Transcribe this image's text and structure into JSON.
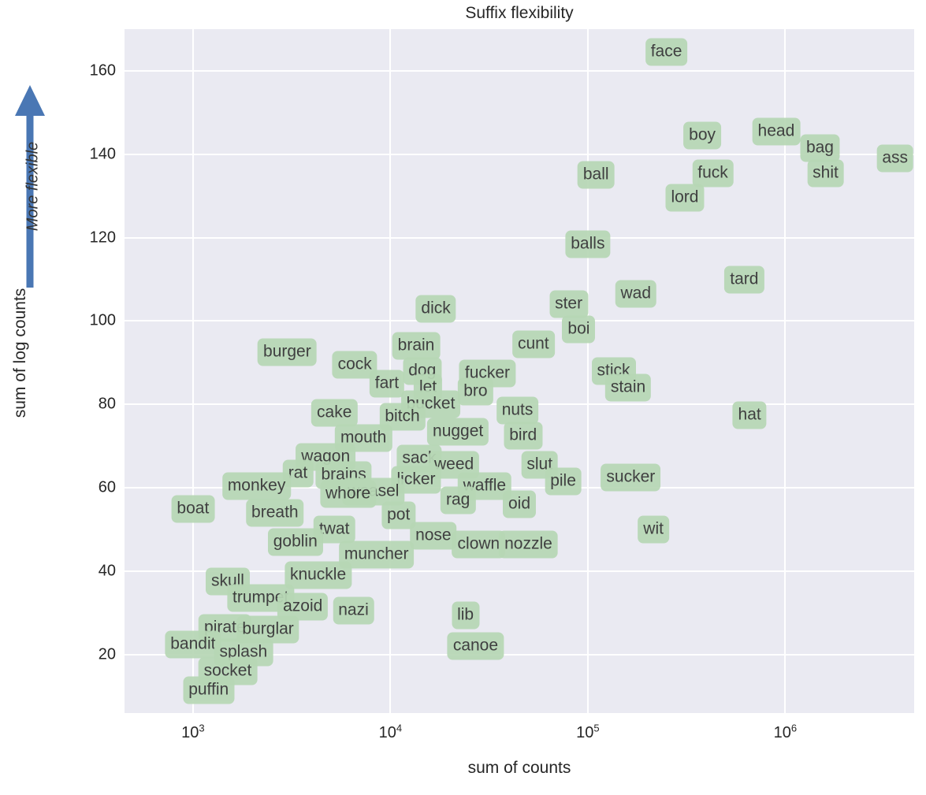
{
  "chart_data": {
    "type": "scatter",
    "title": "Suffix flexibility",
    "xlabel": "sum of counts",
    "ylabel": "sum of log counts",
    "xscale": "log",
    "yscale": "linear",
    "xlim": [
      450,
      4500000
    ],
    "ylim": [
      6,
      170
    ],
    "grid": true,
    "legend": null,
    "xticks": [
      {
        "value": 1000,
        "label_base": "10",
        "label_exp": "3"
      },
      {
        "value": 10000,
        "label_base": "10",
        "label_exp": "4"
      },
      {
        "value": 100000,
        "label_base": "10",
        "label_exp": "5"
      },
      {
        "value": 1000000,
        "label_base": "10",
        "label_exp": "6"
      }
    ],
    "yticks": [
      20,
      40,
      60,
      80,
      100,
      120,
      140,
      160
    ],
    "annotation": {
      "text": "More flexible",
      "arrow_direction": "up",
      "color": "#4a77b4"
    },
    "label_style": {
      "box_color": "#b7d7b5",
      "text_color": "#333333",
      "plot_background": "#eaeaf2",
      "grid_color": "#ffffff"
    },
    "points": [
      {
        "label": "face",
        "x": 250000,
        "y": 164.5
      },
      {
        "label": "boy",
        "x": 380000,
        "y": 144.5
      },
      {
        "label": "head",
        "x": 900000,
        "y": 145.5
      },
      {
        "label": "bag",
        "x": 1500000,
        "y": 141.5
      },
      {
        "label": "ass",
        "x": 3600000,
        "y": 139.0
      },
      {
        "label": "shit",
        "x": 1600000,
        "y": 135.5
      },
      {
        "label": "fuck",
        "x": 430000,
        "y": 135.5
      },
      {
        "label": "ball",
        "x": 110000,
        "y": 135.0
      },
      {
        "label": "lord",
        "x": 310000,
        "y": 129.5
      },
      {
        "label": "balls",
        "x": 100000,
        "y": 118.5
      },
      {
        "label": "tard",
        "x": 620000,
        "y": 110.0
      },
      {
        "label": "wad",
        "x": 175000,
        "y": 106.5
      },
      {
        "label": "ster",
        "x": 80000,
        "y": 104.0
      },
      {
        "label": "dick",
        "x": 17000,
        "y": 103.0
      },
      {
        "label": "boi",
        "x": 90000,
        "y": 98.0
      },
      {
        "label": "cunt",
        "x": 53000,
        "y": 94.5
      },
      {
        "label": "brain",
        "x": 13500,
        "y": 94.0
      },
      {
        "label": "burger",
        "x": 3000,
        "y": 92.5
      },
      {
        "label": "cock",
        "x": 6600,
        "y": 89.5
      },
      {
        "label": "dog",
        "x": 14500,
        "y": 88.0
      },
      {
        "label": "fucker",
        "x": 31000,
        "y": 87.5
      },
      {
        "label": "stick",
        "x": 135000,
        "y": 88.0
      },
      {
        "label": "stain",
        "x": 160000,
        "y": 84.0
      },
      {
        "label": "fart",
        "x": 9600,
        "y": 85.0
      },
      {
        "label": "let",
        "x": 15500,
        "y": 84.0
      },
      {
        "label": "bro",
        "x": 27000,
        "y": 83.0
      },
      {
        "label": "bucket",
        "x": 16000,
        "y": 80.0
      },
      {
        "label": "nuts",
        "x": 44000,
        "y": 78.5
      },
      {
        "label": "cake",
        "x": 5200,
        "y": 78.0
      },
      {
        "label": "bitch",
        "x": 11500,
        "y": 77.0
      },
      {
        "label": "hat",
        "x": 660000,
        "y": 77.5
      },
      {
        "label": "nugget",
        "x": 22000,
        "y": 73.5
      },
      {
        "label": "mouth",
        "x": 7300,
        "y": 72.0
      },
      {
        "label": "bird",
        "x": 47000,
        "y": 72.5
      },
      {
        "label": "wagon",
        "x": 4700,
        "y": 67.5
      },
      {
        "label": "sack",
        "x": 14000,
        "y": 67.0
      },
      {
        "label": "weed",
        "x": 21000,
        "y": 65.5
      },
      {
        "label": "slut",
        "x": 57000,
        "y": 65.5
      },
      {
        "label": "rat",
        "x": 3400,
        "y": 63.5
      },
      {
        "label": "brains",
        "x": 5800,
        "y": 63.0
      },
      {
        "label": "licker",
        "x": 13500,
        "y": 62.0
      },
      {
        "label": "pile",
        "x": 75000,
        "y": 61.5
      },
      {
        "label": "sucker",
        "x": 165000,
        "y": 62.5
      },
      {
        "label": "waffle",
        "x": 30000,
        "y": 60.5
      },
      {
        "label": "monkey",
        "x": 2100,
        "y": 60.5
      },
      {
        "label": "weasel",
        "x": 8200,
        "y": 59.0
      },
      {
        "label": "whore",
        "x": 6100,
        "y": 58.5
      },
      {
        "label": "rag",
        "x": 22000,
        "y": 57.0
      },
      {
        "label": "oid",
        "x": 45000,
        "y": 56.0
      },
      {
        "label": "boat",
        "x": 1000,
        "y": 55.0
      },
      {
        "label": "breath",
        "x": 2600,
        "y": 54.0
      },
      {
        "label": "pot",
        "x": 11000,
        "y": 53.5
      },
      {
        "label": "wit",
        "x": 215000,
        "y": 50.0
      },
      {
        "label": "twat",
        "x": 5200,
        "y": 50.0
      },
      {
        "label": "nose",
        "x": 16500,
        "y": 48.5
      },
      {
        "label": "goblin",
        "x": 3300,
        "y": 47.0
      },
      {
        "label": "clown",
        "x": 28000,
        "y": 46.5
      },
      {
        "label": "nozzle",
        "x": 50000,
        "y": 46.5
      },
      {
        "label": "muncher",
        "x": 8500,
        "y": 44.0
      },
      {
        "label": "knuckle",
        "x": 4300,
        "y": 39.0
      },
      {
        "label": "skull",
        "x": 1500,
        "y": 37.5
      },
      {
        "label": "trumpet",
        "x": 2200,
        "y": 33.5
      },
      {
        "label": "azoid",
        "x": 3600,
        "y": 31.5
      },
      {
        "label": "nazi",
        "x": 6500,
        "y": 30.5
      },
      {
        "label": "lib",
        "x": 24000,
        "y": 29.5
      },
      {
        "label": "pirate",
        "x": 1450,
        "y": 26.5
      },
      {
        "label": "burglar",
        "x": 2400,
        "y": 26.0
      },
      {
        "label": "bandit",
        "x": 1000,
        "y": 22.5
      },
      {
        "label": "canoe",
        "x": 27000,
        "y": 22.0
      },
      {
        "label": "splash",
        "x": 1800,
        "y": 20.5
      },
      {
        "label": "socket",
        "x": 1500,
        "y": 16.0
      },
      {
        "label": "puffin",
        "x": 1200,
        "y": 11.5
      }
    ]
  }
}
